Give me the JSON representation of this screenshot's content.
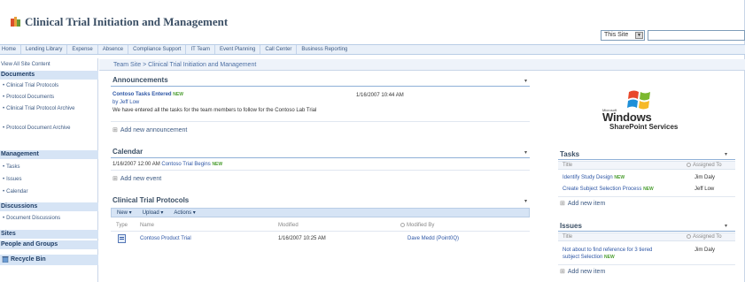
{
  "header": {
    "site_title": "Clinical Trial Initiation and Management",
    "search_scope": "This Site"
  },
  "topnav": {
    "tabs": [
      "Home",
      "Lending Library",
      "Expense",
      "Absence",
      "Compliance Support",
      "IT Team",
      "Event Planning",
      "Call Center",
      "Business Reporting"
    ]
  },
  "quicklaunch": {
    "view_all": "View All Site Content",
    "documents_header": "Documents",
    "documents_items": [
      "Clinical Trial Protocols",
      "Protocol Documents",
      "Clinical Trial Protocol Archive",
      "Protocol Document Archive"
    ],
    "management_header": "Management",
    "management_items": [
      "Tasks",
      "Issues",
      "Calendar"
    ],
    "discussions_header": "Discussions",
    "discussions_items": [
      "Document Discussions"
    ],
    "sites_header": "Sites",
    "people_header": "People and Groups",
    "recycle_bin": "Recycle Bin"
  },
  "breadcrumb": "Team Site > Clinical Trial Initiation and Management",
  "announcements": {
    "title": "Announcements",
    "item_title": "Contoso Tasks Entered",
    "new_badge": "NEW",
    "date": "1/16/2007 10:44 AM",
    "author": "by Jeff Low",
    "body": "We have entered all the tasks for the team members to follow for the Contoso Lab Trial",
    "add_new": "Add new announcement"
  },
  "calendar": {
    "title": "Calendar",
    "event_date": "1/16/2007 12:00 AM",
    "event_title": "Contoso Trial Begins",
    "new_badge": "NEW",
    "add_new": "Add new event"
  },
  "protocols": {
    "title": "Clinical Trial Protocols",
    "toolbar": [
      "New",
      "Upload",
      "Actions"
    ],
    "columns": [
      "Type",
      "Name",
      "Modified",
      "Modified By"
    ],
    "rows": [
      {
        "name": "Contoso Product Trial",
        "modified": "1/16/2007 10:25 AM",
        "modified_by": "Dave Medd (Point0Q)"
      }
    ]
  },
  "logo": {
    "microsoft": "Microsoft",
    "windows": "Windows",
    "sharepoint": "SharePoint Services"
  },
  "tasks": {
    "title": "Tasks",
    "columns": [
      "Title",
      "Assigned To"
    ],
    "rows": [
      {
        "title": "Identify Study Design",
        "assigned": "Jim Daly"
      },
      {
        "title": "Create Subject Selection Process",
        "assigned": "Jeff Low"
      }
    ],
    "new_badge": "NEW",
    "add_new": "Add new item"
  },
  "issues": {
    "title": "Issues",
    "columns": [
      "Title",
      "Assigned To"
    ],
    "rows": [
      {
        "title_line1": "Not about to find reference for 3 tiered",
        "title_line2": "subject Selection",
        "assigned": "Jim Daly"
      }
    ],
    "new_badge": "NEW",
    "add_new": "Add new item"
  },
  "colors": {
    "accent": "#3b4f65",
    "link": "#2d56a5",
    "nav_bg": "#e9f0f9",
    "new_badge": "#4a9d2f"
  }
}
